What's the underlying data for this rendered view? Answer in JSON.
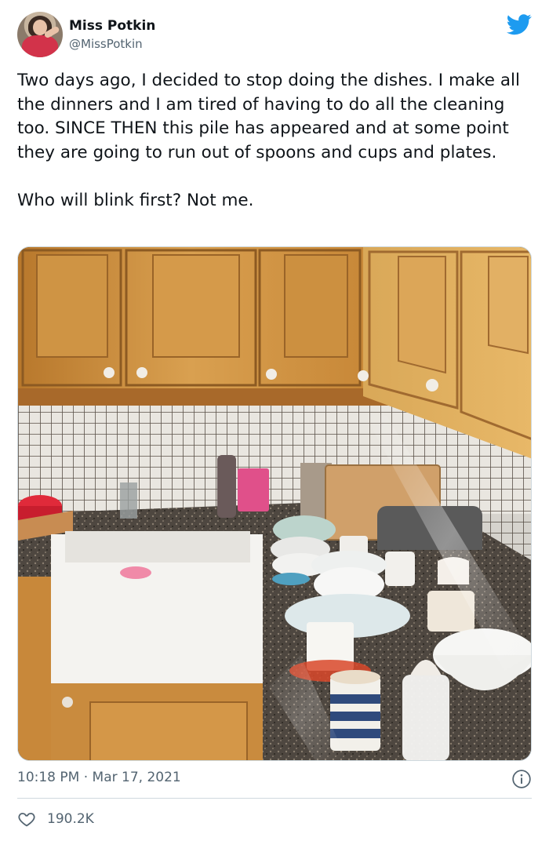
{
  "author": {
    "name": "Miss Potkin",
    "handle": "@MissPotkin",
    "avatar_icon": "profile-avatar"
  },
  "brand": {
    "icon": "twitter-bird-icon",
    "color": "#1d9bf0"
  },
  "tweet": {
    "text": "Two days ago, I decided to stop doing the dishes. I make all the dinners and I am tired of having to do all the cleaning too. SINCE THEN this pile has appeared and at some point they are going to run out of spoons and cups and plates.\n\nWho will blink first? Not me.",
    "timestamp": "10:18 PM · Mar 17, 2021"
  },
  "stats": {
    "likes": "190.2K"
  },
  "colors": {
    "text": "#0f1419",
    "muted": "#536471",
    "border": "#cfd9de",
    "cabinet": "#c98d3c"
  }
}
